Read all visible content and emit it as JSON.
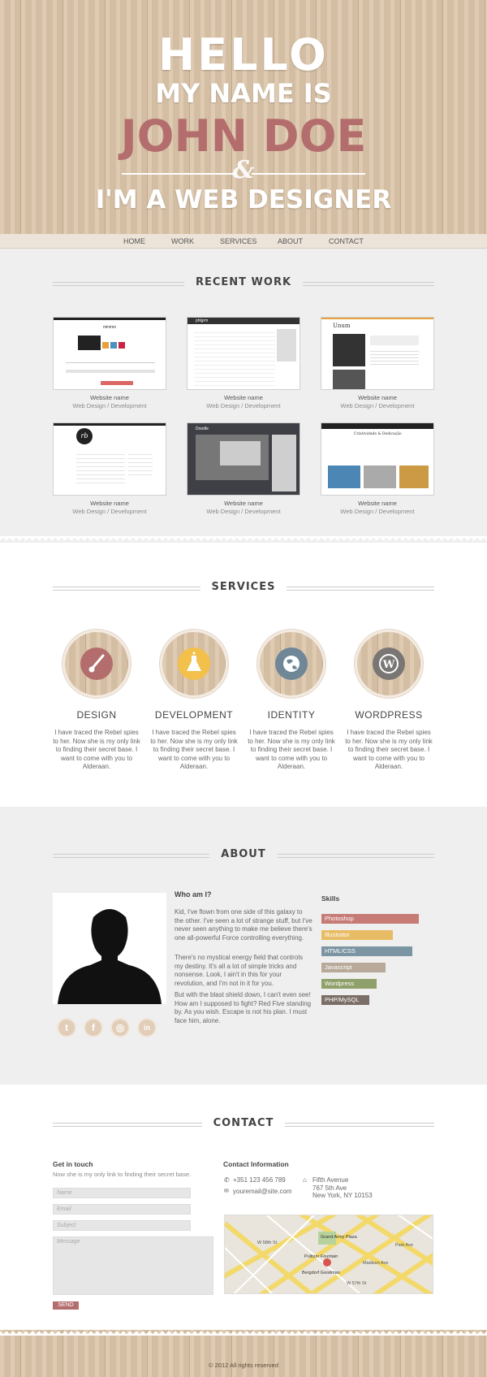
{
  "hero": {
    "line1": "HELLO",
    "line2": "MY NAME IS",
    "line3": "JOHN DOE",
    "ampersand": "&",
    "line4": "I'M A WEB DESIGNER"
  },
  "nav": [
    "HOME",
    "WORK",
    "SERVICES",
    "ABOUT",
    "CONTACT"
  ],
  "recent_work": {
    "title": "RECENT WORK",
    "items": [
      {
        "name": "Website name",
        "tag": "Web Design / Development",
        "thumb_label": "minimo"
      },
      {
        "name": "Website name",
        "tag": "Web Design / Development",
        "thumb_label": "phlgrm"
      },
      {
        "name": "Website name",
        "tag": "Web Design / Development",
        "thumb_label": "Unum"
      },
      {
        "name": "Website name",
        "tag": "Web Design / Development",
        "thumb_label": "rb"
      },
      {
        "name": "Website name",
        "tag": "Web Design / Development",
        "thumb_label": "Doodle"
      },
      {
        "name": "Website name",
        "tag": "Web Design / Development",
        "thumb_label": "Criatividade & Dedicação"
      }
    ]
  },
  "services": {
    "title": "SERVICES",
    "items": [
      {
        "title": "DESIGN",
        "icon": "brush-icon",
        "color": "#b46d6d",
        "text": "I have traced the Rebel spies to her. Now she is my only link to finding their secret base. I want to come with you to Alderaan."
      },
      {
        "title": "DEVELOPMENT",
        "icon": "flask-icon",
        "color": "#f2c04b",
        "text": "I have traced the Rebel spies to her. Now she is my only link to finding their secret base. I want to come with you to Alderaan."
      },
      {
        "title": "IDENTITY",
        "icon": "globe-icon",
        "color": "#6f8797",
        "text": "I have traced the Rebel spies to her. Now she is my only link to finding their secret base. I want to come with you to Alderaan."
      },
      {
        "title": "WORDPRESS",
        "icon": "wordpress-icon",
        "color": "#7a7674",
        "text": "I have traced the Rebel spies to her. Now she is my only link to finding their secret base. I want to come with you to Alderaan."
      }
    ]
  },
  "about": {
    "title": "ABOUT",
    "who_title": "Who am I?",
    "p1": "Kid, I've flown from one side of this galaxy to the other. I've seen a lot of strange stuff, but I've never seen anything to make me believe there's one all-powerful Force controlling everything.",
    "p2": "There's no mystical energy field that controls my destiny. It's all a lot of simple tricks and nonsense. Look, I ain't in this for your revolution, and I'm not in it for you.",
    "p3": "But with the blast shield down, I can't even see! How am I supposed to fight? Red Five standing by. As you wish. Escape is not his plan. I must face him, alone.",
    "skills_title": "Skills",
    "skills": [
      {
        "name": "Photoshop",
        "color": "#c77b76",
        "level": 1.0
      },
      {
        "name": "Illustrator",
        "color": "#e8bc64",
        "level": 0.73
      },
      {
        "name": "HTML/CSS",
        "color": "#7c95a3",
        "level": 0.93
      },
      {
        "name": "Javascript",
        "color": "#b8a99a",
        "level": 0.66
      },
      {
        "name": "Wordpress",
        "color": "#8fa06b",
        "level": 0.57
      },
      {
        "name": "PHP/MySQL",
        "color": "#7b6e66",
        "level": 0.49
      }
    ],
    "social": [
      {
        "icon": "twitter-icon",
        "glyph": "t"
      },
      {
        "icon": "facebook-icon",
        "glyph": "f"
      },
      {
        "icon": "dribbble-icon",
        "glyph": "◎"
      },
      {
        "icon": "linkedin-icon",
        "glyph": "in"
      }
    ]
  },
  "contact": {
    "title": "CONTACT",
    "get_in_touch": "Get in touch",
    "subtitle": "Now she is my only link to finding their secret base.",
    "name_placeholder": "Name",
    "email_placeholder": "Email",
    "subject_placeholder": "Subject",
    "message_placeholder": "Message",
    "send": "SEND",
    "info_title": "Contact Information",
    "phone": "+351 123 456 789",
    "email": "youremail@site.com",
    "address1": "Fifth Avenue",
    "address2": "767 5th Ave",
    "address3": "New York, NY 10153",
    "map_labels": [
      "Grand Army Plaza",
      "Pulitzer Fountain",
      "Bergdorf Goodman",
      "W 58th St",
      "W 57th St",
      "Madison Ave",
      "Park Ave"
    ]
  },
  "footer": {
    "text": "© 2012 All rights reserved"
  }
}
